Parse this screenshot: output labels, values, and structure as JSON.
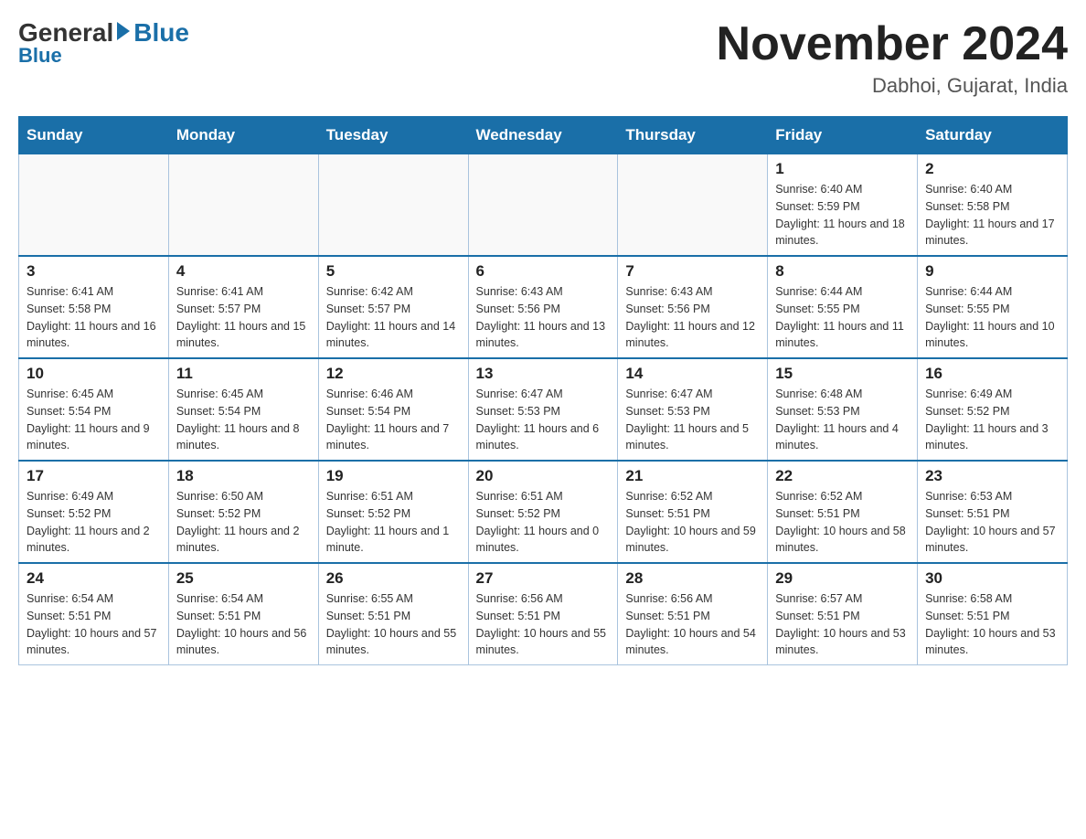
{
  "header": {
    "logo": {
      "general": "General",
      "blue": "Blue"
    },
    "title": "November 2024",
    "subtitle": "Dabhoi, Gujarat, India"
  },
  "days_of_week": [
    "Sunday",
    "Monday",
    "Tuesday",
    "Wednesday",
    "Thursday",
    "Friday",
    "Saturday"
  ],
  "weeks": [
    [
      {
        "day": "",
        "info": ""
      },
      {
        "day": "",
        "info": ""
      },
      {
        "day": "",
        "info": ""
      },
      {
        "day": "",
        "info": ""
      },
      {
        "day": "",
        "info": ""
      },
      {
        "day": "1",
        "info": "Sunrise: 6:40 AM\nSunset: 5:59 PM\nDaylight: 11 hours and 18 minutes."
      },
      {
        "day": "2",
        "info": "Sunrise: 6:40 AM\nSunset: 5:58 PM\nDaylight: 11 hours and 17 minutes."
      }
    ],
    [
      {
        "day": "3",
        "info": "Sunrise: 6:41 AM\nSunset: 5:58 PM\nDaylight: 11 hours and 16 minutes."
      },
      {
        "day": "4",
        "info": "Sunrise: 6:41 AM\nSunset: 5:57 PM\nDaylight: 11 hours and 15 minutes."
      },
      {
        "day": "5",
        "info": "Sunrise: 6:42 AM\nSunset: 5:57 PM\nDaylight: 11 hours and 14 minutes."
      },
      {
        "day": "6",
        "info": "Sunrise: 6:43 AM\nSunset: 5:56 PM\nDaylight: 11 hours and 13 minutes."
      },
      {
        "day": "7",
        "info": "Sunrise: 6:43 AM\nSunset: 5:56 PM\nDaylight: 11 hours and 12 minutes."
      },
      {
        "day": "8",
        "info": "Sunrise: 6:44 AM\nSunset: 5:55 PM\nDaylight: 11 hours and 11 minutes."
      },
      {
        "day": "9",
        "info": "Sunrise: 6:44 AM\nSunset: 5:55 PM\nDaylight: 11 hours and 10 minutes."
      }
    ],
    [
      {
        "day": "10",
        "info": "Sunrise: 6:45 AM\nSunset: 5:54 PM\nDaylight: 11 hours and 9 minutes."
      },
      {
        "day": "11",
        "info": "Sunrise: 6:45 AM\nSunset: 5:54 PM\nDaylight: 11 hours and 8 minutes."
      },
      {
        "day": "12",
        "info": "Sunrise: 6:46 AM\nSunset: 5:54 PM\nDaylight: 11 hours and 7 minutes."
      },
      {
        "day": "13",
        "info": "Sunrise: 6:47 AM\nSunset: 5:53 PM\nDaylight: 11 hours and 6 minutes."
      },
      {
        "day": "14",
        "info": "Sunrise: 6:47 AM\nSunset: 5:53 PM\nDaylight: 11 hours and 5 minutes."
      },
      {
        "day": "15",
        "info": "Sunrise: 6:48 AM\nSunset: 5:53 PM\nDaylight: 11 hours and 4 minutes."
      },
      {
        "day": "16",
        "info": "Sunrise: 6:49 AM\nSunset: 5:52 PM\nDaylight: 11 hours and 3 minutes."
      }
    ],
    [
      {
        "day": "17",
        "info": "Sunrise: 6:49 AM\nSunset: 5:52 PM\nDaylight: 11 hours and 2 minutes."
      },
      {
        "day": "18",
        "info": "Sunrise: 6:50 AM\nSunset: 5:52 PM\nDaylight: 11 hours and 2 minutes."
      },
      {
        "day": "19",
        "info": "Sunrise: 6:51 AM\nSunset: 5:52 PM\nDaylight: 11 hours and 1 minute."
      },
      {
        "day": "20",
        "info": "Sunrise: 6:51 AM\nSunset: 5:52 PM\nDaylight: 11 hours and 0 minutes."
      },
      {
        "day": "21",
        "info": "Sunrise: 6:52 AM\nSunset: 5:51 PM\nDaylight: 10 hours and 59 minutes."
      },
      {
        "day": "22",
        "info": "Sunrise: 6:52 AM\nSunset: 5:51 PM\nDaylight: 10 hours and 58 minutes."
      },
      {
        "day": "23",
        "info": "Sunrise: 6:53 AM\nSunset: 5:51 PM\nDaylight: 10 hours and 57 minutes."
      }
    ],
    [
      {
        "day": "24",
        "info": "Sunrise: 6:54 AM\nSunset: 5:51 PM\nDaylight: 10 hours and 57 minutes."
      },
      {
        "day": "25",
        "info": "Sunrise: 6:54 AM\nSunset: 5:51 PM\nDaylight: 10 hours and 56 minutes."
      },
      {
        "day": "26",
        "info": "Sunrise: 6:55 AM\nSunset: 5:51 PM\nDaylight: 10 hours and 55 minutes."
      },
      {
        "day": "27",
        "info": "Sunrise: 6:56 AM\nSunset: 5:51 PM\nDaylight: 10 hours and 55 minutes."
      },
      {
        "day": "28",
        "info": "Sunrise: 6:56 AM\nSunset: 5:51 PM\nDaylight: 10 hours and 54 minutes."
      },
      {
        "day": "29",
        "info": "Sunrise: 6:57 AM\nSunset: 5:51 PM\nDaylight: 10 hours and 53 minutes."
      },
      {
        "day": "30",
        "info": "Sunrise: 6:58 AM\nSunset: 5:51 PM\nDaylight: 10 hours and 53 minutes."
      }
    ]
  ]
}
